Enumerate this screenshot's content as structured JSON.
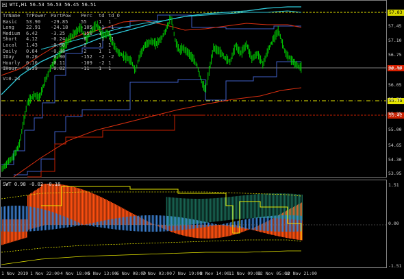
{
  "header": {
    "symbol_timeframe": "WTI,H1",
    "quote": "56.53 56.53 56.45 56.51"
  },
  "power_table": {
    "columns": [
      "TrName",
      "TrPower",
      "PartPow",
      "Perc",
      "td",
      "td_O"
    ],
    "rows": [
      [
        "Basic",
        "53.90",
        "-29.85",
        "55",
        "1",
        "1"
      ],
      [
        "Long",
        "22.91",
        "-24.18",
        "-105",
        "-1",
        "-1"
      ],
      [
        "Medium",
        "6.42",
        "-3.25",
        "-150",
        "1",
        "1"
      ],
      [
        "Short",
        "4.12",
        "-0.24",
        "-6",
        "-1",
        "-1"
      ],
      [
        "Local",
        "1.43",
        "-0.60",
        "-2",
        "1",
        "1"
      ],
      [
        "Daily",
        "0.64",
        "-0.48",
        "-2",
        "1",
        "1"
      ],
      [
        "IDay",
        "0.20",
        "-0.30",
        "-152",
        "-2",
        "-2"
      ],
      [
        "Hourly",
        "0.10",
        "-0.11",
        "-109",
        "-2",
        "1"
      ],
      [
        "IHour",
        "0.39",
        "-0.02",
        "-11",
        "1",
        "1"
      ]
    ],
    "v_label": "V=0.24"
  },
  "price_labels": [
    {
      "value": "57.83",
      "bg": "#d8d800",
      "fg": "#000000"
    },
    {
      "value": "56.58",
      "bg": "#d82000",
      "fg": "#ffffff"
    },
    {
      "value": "55.76",
      "bg": "#e6e600",
      "fg": "#000000"
    },
    {
      "value": "55.42",
      "bg": "#c82000",
      "fg": "#ffffff"
    }
  ],
  "price_axis_ticks": [
    "57.45",
    "57.10",
    "56.75",
    "56.40",
    "56.05",
    "55.70",
    "55.35",
    "55.00",
    "54.65",
    "54.30",
    "53.95"
  ],
  "subwindow": {
    "title": "SWT 0.98 -0.02 -0.18",
    "axis_ticks": [
      "1.51",
      "0.00",
      "-1.51"
    ]
  },
  "time_axis": [
    "1 Nov 2019",
    "1 Nov 22:00",
    "4 Nov 18:00",
    "5 Nov 13:00",
    "6 Nov 08:00",
    "7 Nov 03:00",
    "7 Nov 19:00",
    "8 Nov 14:00",
    "11 Nov 09:00",
    "12 Nov 05:00",
    "12 Nov 21:00"
  ],
  "colors": {
    "background": "#000000",
    "candles": "#00d000",
    "grid_divider": "#808080",
    "ma_cyan": "#2ec8d8",
    "ma_red": "#e03010",
    "channel_blue": "#4060c8",
    "level_yellow": "#e6e600",
    "histogram_orange": "#ff5010",
    "histogram_blue": "#3d82d4",
    "histogram_teal": "#2aa88a"
  },
  "icons": {
    "chart_icon": "chart-icon"
  }
}
